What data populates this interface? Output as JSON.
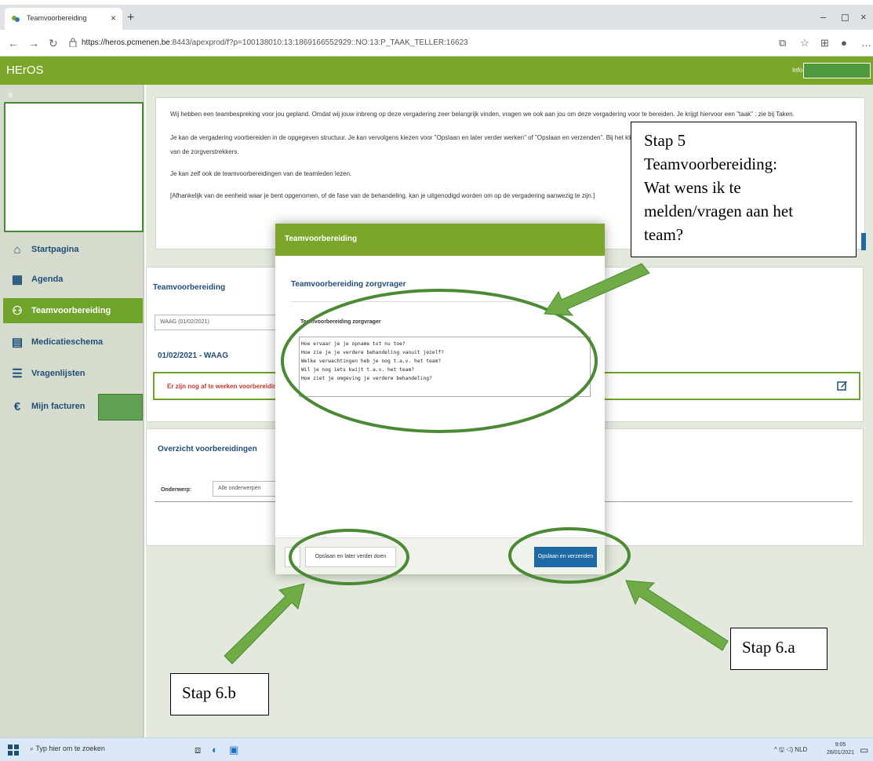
{
  "browser": {
    "tab_title": "Teamvoorbereiding",
    "tab_close": "×",
    "new_tab": "+",
    "url_host": "https://heros.pcmenen.be",
    "url_path": ":8443/apexprod/f?p=100138010:13:1869166552929::NO:13:P_TAAK_TELLER:16623",
    "min": "–",
    "max": "◻",
    "close": "×"
  },
  "app": {
    "brand": "HErOS",
    "info_label": "Info"
  },
  "sidebar": {
    "menu_icon": "≡",
    "items": [
      {
        "label": "Startpagina",
        "icon": "home-icon"
      },
      {
        "label": "Agenda",
        "icon": "calendar-icon"
      },
      {
        "label": "Teamvoorbereiding",
        "icon": "team-icon",
        "active": true
      },
      {
        "label": "Medicatieschema",
        "icon": "document-icon"
      },
      {
        "label": "Vragenlijsten",
        "icon": "list-icon"
      },
      {
        "label": "Mijn facturen",
        "icon": "euro-icon"
      }
    ]
  },
  "intro": {
    "line1": "Wij hebben een teambespreking voor jou gepland. Omdat wij jouw inbreng op deze vergadering zeer belangrijk vinden, vragen we ook aan jou om deze vergadering voor te bereiden. Je krijgt hiervoor een \"taak\" : zie bij Taken.",
    "line2": "Je kan de vergadering voorbereiden in de opgegeven structuur. Je kan vervolgens kiezen voor \"Opslaan en later verder werken\" of \"Opslaan en verzenden\". Bij het klikken",
    "line3": "van de zorgverstrekkers.",
    "line4": "Je kan zelf ook de teamvoorbereidingen van de teamleden lezen.",
    "line5": "[Afhankelijk van de eenheid waar je bent opgenomen, of de fase van de behandeling, kan je uitgenodigd worden om op de vergadering aanwezig te zijn.]"
  },
  "panel1": {
    "title": "Teamvoorbereiding",
    "select_value": "WAAG (01/02/2021)",
    "date_heading": "01/02/2021 - WAAG",
    "warning": "Er zijn nog af te werken voorbereiding"
  },
  "panel2": {
    "title": "Overzicht voorbereidingen",
    "onderwerp_label": "Onderwerp:",
    "onderwerp_value": "Alle onderwerpen"
  },
  "modal": {
    "title": "Teamvoorbereiding",
    "subtitle": "Teamvoorbereiding zorgvrager",
    "field_label": "Teamvoorbereiding zorgvrager",
    "lines": [
      "Hoe ervaar je je opname tot nu toe?",
      "Hoe zie je je verdere behandeling vanuit jezelf?",
      "Welke verwachtingen heb je nog t.a.v. het team?",
      "Wil je nog iets kwijt t.a.v. het team?",
      "Hoe ziet je omgeving je verdere behandeling?"
    ],
    "btn_later": "Opslaan en later verder doen",
    "btn_send": "Opslaan en verzenden"
  },
  "callouts": {
    "stap5_l1": "Stap 5",
    "stap5_l2": "Teamvoorbereiding:",
    "stap5_l3": "Wat wens ik te",
    "stap5_l4": "melden/vragen aan het",
    "stap5_l5": "team?",
    "stap6a": "Stap 6.a",
    "stap6b": "Stap 6.b"
  },
  "taskbar": {
    "search_placeholder": "Typ hier om te zoeken",
    "tray": "^ 🖫 ◁) NLD",
    "time": "9:05",
    "date": "28/01/2021"
  },
  "colors": {
    "brand_green": "#7ba62a",
    "nav_blue": "#1f4e79",
    "primary_button": "#1f6aa5",
    "annotation_green": "#4b8a35",
    "warning_red": "#c0392b"
  }
}
